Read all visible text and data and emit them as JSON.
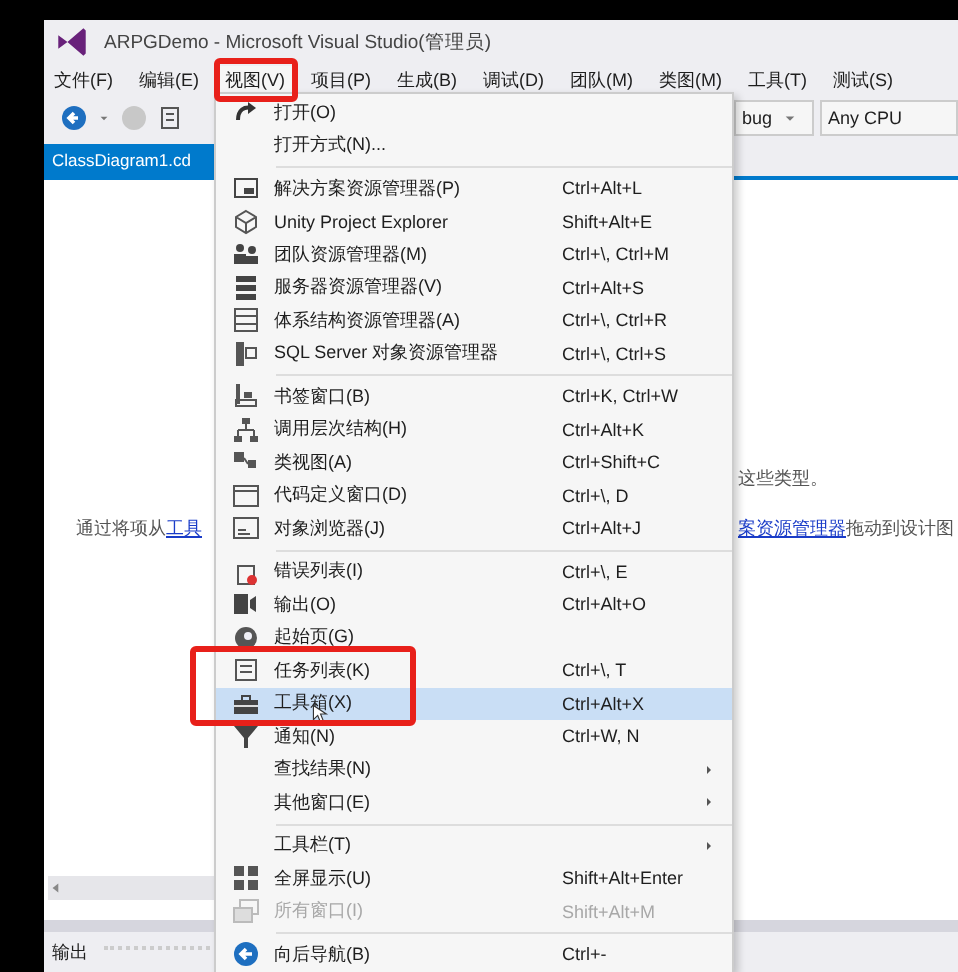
{
  "window": {
    "title": "ARPGDemo - Microsoft Visual Studio(管理员)"
  },
  "menubar": [
    {
      "label": "文件(F)",
      "selected": false
    },
    {
      "label": "编辑(E)",
      "selected": false
    },
    {
      "label": "视图(V)",
      "selected": true
    },
    {
      "label": "项目(P)",
      "selected": false
    },
    {
      "label": "生成(B)",
      "selected": false
    },
    {
      "label": "调试(D)",
      "selected": false
    },
    {
      "label": "团队(M)",
      "selected": false
    },
    {
      "label": "类图(M)",
      "selected": false
    },
    {
      "label": "工具(T)",
      "selected": false
    },
    {
      "label": "测试(S)",
      "selected": false
    }
  ],
  "toolbar": {
    "configuration": "bug",
    "platform": "Any CPU"
  },
  "tabs": [
    {
      "label": "ClassDiagram1.cd",
      "selected": true
    }
  ],
  "designer": {
    "text_right_top": "这些类型。",
    "hint_left": "通过将项从 ",
    "hint_link_left": "工具",
    "hint_link_right": "案资源管理器",
    "hint_right": " 拖动到设计图"
  },
  "output_panel": {
    "title": "输出"
  },
  "menu": [
    {
      "kind": "item",
      "label": "打开(O)",
      "submenu": false,
      "disabled": false,
      "selected": false
    },
    {
      "kind": "item",
      "label": "打开方式(N)...",
      "submenu": false,
      "disabled": false,
      "selected": false
    },
    {
      "kind": "separator"
    },
    {
      "kind": "item",
      "label": "解决方案资源管理器(P)",
      "shortcut": "Ctrl+Alt+L",
      "submenu": false,
      "disabled": false,
      "selected": false
    },
    {
      "kind": "item",
      "label": "Unity Project Explorer",
      "shortcut": "Shift+Alt+E",
      "submenu": false,
      "disabled": false,
      "selected": false
    },
    {
      "kind": "item",
      "label": "团队资源管理器(M)",
      "shortcut": "Ctrl+\\, Ctrl+M",
      "submenu": false,
      "disabled": false,
      "selected": false
    },
    {
      "kind": "item",
      "label": "服务器资源管理器(V)",
      "shortcut": "Ctrl+Alt+S",
      "submenu": false,
      "disabled": false,
      "selected": false
    },
    {
      "kind": "item",
      "label": "体系结构资源管理器(A)",
      "shortcut": "Ctrl+\\, Ctrl+R",
      "submenu": false,
      "disabled": false,
      "selected": false
    },
    {
      "kind": "item",
      "label": "SQL Server 对象资源管理器",
      "shortcut": "Ctrl+\\, Ctrl+S",
      "submenu": false,
      "disabled": false,
      "selected": false
    },
    {
      "kind": "separator"
    },
    {
      "kind": "item",
      "label": "书签窗口(B)",
      "shortcut": "Ctrl+K, Ctrl+W",
      "submenu": false,
      "disabled": false,
      "selected": false
    },
    {
      "kind": "item",
      "label": "调用层次结构(H)",
      "shortcut": "Ctrl+Alt+K",
      "submenu": false,
      "disabled": false,
      "selected": false
    },
    {
      "kind": "item",
      "label": "类视图(A)",
      "shortcut": "Ctrl+Shift+C",
      "submenu": false,
      "disabled": false,
      "selected": false
    },
    {
      "kind": "item",
      "label": "代码定义窗口(D)",
      "shortcut": "Ctrl+\\, D",
      "submenu": false,
      "disabled": false,
      "selected": false
    },
    {
      "kind": "item",
      "label": "对象浏览器(J)",
      "shortcut": "Ctrl+Alt+J",
      "submenu": false,
      "disabled": false,
      "selected": false
    },
    {
      "kind": "separator"
    },
    {
      "kind": "item",
      "label": "错误列表(I)",
      "shortcut": "Ctrl+\\, E",
      "submenu": false,
      "disabled": false,
      "selected": false
    },
    {
      "kind": "item",
      "label": "输出(O)",
      "shortcut": "Ctrl+Alt+O",
      "submenu": false,
      "disabled": false,
      "selected": false
    },
    {
      "kind": "item",
      "label": "起始页(G)",
      "submenu": false,
      "disabled": false,
      "selected": false
    },
    {
      "kind": "item",
      "label": "任务列表(K)",
      "shortcut": "Ctrl+\\, T",
      "submenu": false,
      "disabled": false,
      "selected": false
    },
    {
      "kind": "item",
      "label": "工具箱(X)",
      "shortcut": "Ctrl+Alt+X",
      "submenu": false,
      "disabled": false,
      "selected": true
    },
    {
      "kind": "item",
      "label": "通知(N)",
      "shortcut": "Ctrl+W, N",
      "submenu": false,
      "disabled": false,
      "selected": false
    },
    {
      "kind": "item",
      "label": "查找结果(N)",
      "submenu": true,
      "disabled": false,
      "selected": false
    },
    {
      "kind": "item",
      "label": "其他窗口(E)",
      "submenu": true,
      "disabled": false,
      "selected": false
    },
    {
      "kind": "separator"
    },
    {
      "kind": "item",
      "label": "工具栏(T)",
      "submenu": true,
      "disabled": false,
      "selected": false
    },
    {
      "kind": "item",
      "label": "全屏显示(U)",
      "shortcut": "Shift+Alt+Enter",
      "submenu": false,
      "disabled": false,
      "selected": false
    },
    {
      "kind": "item",
      "label": "所有窗口(I)",
      "shortcut": "Shift+Alt+M",
      "submenu": false,
      "disabled": true,
      "selected": false
    },
    {
      "kind": "separator"
    },
    {
      "kind": "item",
      "label": "向后导航(B)",
      "shortcut": "Ctrl+-",
      "submenu": false,
      "disabled": false,
      "selected": false
    }
  ]
}
